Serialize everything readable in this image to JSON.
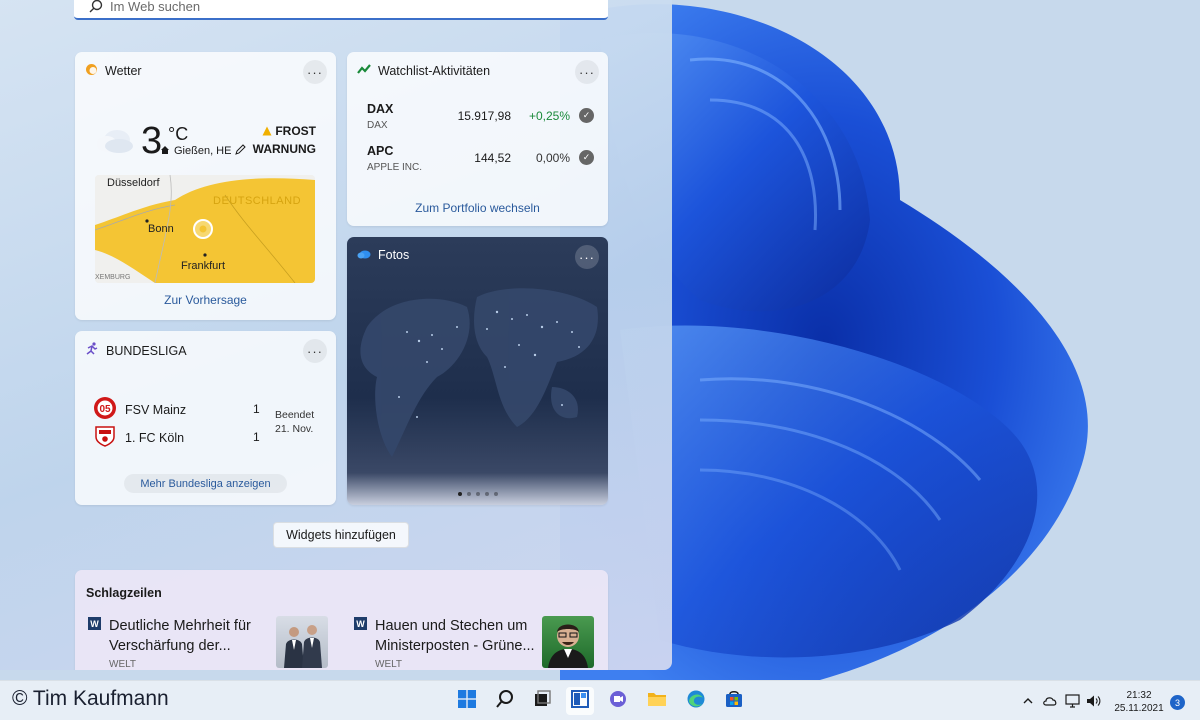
{
  "search": {
    "placeholder": "Im Web suchen"
  },
  "weather": {
    "title": "Wetter",
    "location": "Gießen, HE",
    "temperature": "3",
    "unit": "°C",
    "alert_line1": "FROST",
    "alert_line2": "WARNUNG",
    "map_labels": {
      "duesseldorf": "Düsseldorf",
      "bonn": "Bonn",
      "frankfurt": "Frankfurt",
      "deutschland": "DEUTSCHLAND",
      "luxemburg": "XEMBURG"
    },
    "forecast_link": "Zur Vorhersage"
  },
  "watchlist": {
    "title": "Watchlist-Aktivitäten",
    "stocks": [
      {
        "symbol": "DAX",
        "name": "DAX",
        "price": "15.917,98",
        "change": "+0,25%",
        "change_color": "#1a8a3a"
      },
      {
        "symbol": "APC",
        "name": "APPLE INC.",
        "price": "144,52",
        "change": "0,00%",
        "change_color": "#333333"
      }
    ],
    "portfolio_link": "Zum Portfolio wechseln"
  },
  "photos": {
    "title": "Fotos",
    "page_count": 5,
    "active_page": 1
  },
  "bundesliga": {
    "title": "BUNDESLIGA",
    "teams": [
      {
        "name": "FSV Mainz",
        "score": "1"
      },
      {
        "name": "1. FC Köln",
        "score": "1"
      }
    ],
    "status_line1": "Beendet",
    "status_line2": "21. Nov.",
    "more_link": "Mehr Bundesliga anzeigen"
  },
  "add_widgets_label": "Widgets hinzufügen",
  "headlines": {
    "title": "Schlagzeilen",
    "articles": [
      {
        "headline": "Deutliche Mehrheit für Verschärfung der...",
        "source": "WELT",
        "source_icon": "W"
      },
      {
        "headline": "Hauen und Stechen um Ministerposten - Grüne...",
        "source": "WELT",
        "source_icon": "W"
      }
    ]
  },
  "copyright": "© Tim Kaufmann",
  "taskbar": {
    "time": "21:32",
    "date": "25.11.2021",
    "notification_count": "3",
    "icons": [
      "start-icon",
      "search-icon",
      "task-view-icon",
      "widgets-icon",
      "teams-chat-icon",
      "file-explorer-icon",
      "edge-icon",
      "store-icon"
    ]
  },
  "colors": {
    "accent": "#1e64c8",
    "link": "#2a5a9c",
    "positive": "#1a8a3a"
  }
}
